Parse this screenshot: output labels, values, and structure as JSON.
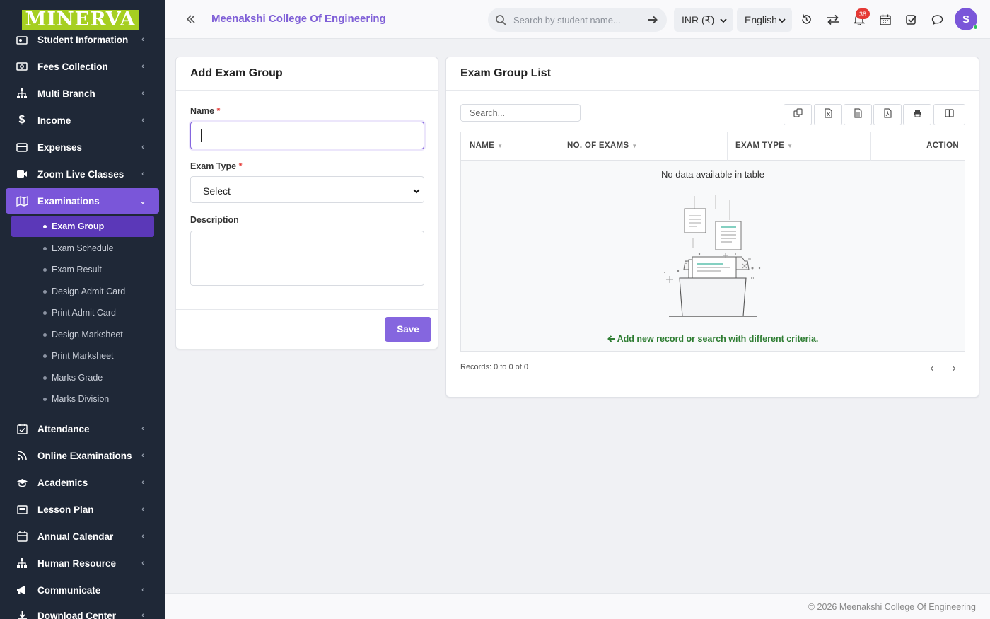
{
  "logo": {
    "text": "MINERVA",
    "color": "#a6cf21"
  },
  "sidebar": {
    "items": [
      {
        "label": "Student Information",
        "icon": "student-info-icon"
      },
      {
        "label": "Fees Collection",
        "icon": "money-icon"
      },
      {
        "label": "Multi Branch",
        "icon": "sitemap-icon"
      },
      {
        "label": "Income",
        "icon": "dollar-icon"
      },
      {
        "label": "Expenses",
        "icon": "credit-card-icon"
      },
      {
        "label": "Zoom Live Classes",
        "icon": "video-icon"
      },
      {
        "label": "Examinations",
        "icon": "map-icon",
        "active": true
      },
      {
        "label": "Attendance",
        "icon": "calendar-check-icon"
      },
      {
        "label": "Online Examinations",
        "icon": "rss-icon"
      },
      {
        "label": "Academics",
        "icon": "graduation-cap-icon"
      },
      {
        "label": "Lesson Plan",
        "icon": "list-icon"
      },
      {
        "label": "Annual Calendar",
        "icon": "calendar-icon"
      },
      {
        "label": "Human Resource",
        "icon": "sitemap-icon"
      },
      {
        "label": "Communicate",
        "icon": "megaphone-icon"
      },
      {
        "label": "Download Center",
        "icon": "download-icon"
      }
    ],
    "subitems": [
      {
        "label": "Exam Group",
        "active": true
      },
      {
        "label": "Exam Schedule"
      },
      {
        "label": "Exam Result"
      },
      {
        "label": "Design Admit Card"
      },
      {
        "label": "Print Admit Card"
      },
      {
        "label": "Design Marksheet"
      },
      {
        "label": "Print Marksheet"
      },
      {
        "label": "Marks Grade"
      },
      {
        "label": "Marks Division"
      }
    ]
  },
  "topbar": {
    "college": "Meenakshi College Of Engineering",
    "search_placeholder": "Search by student name...",
    "currency": "INR (₹)",
    "language": "English",
    "notification_count": "38",
    "avatar_initial": "S"
  },
  "form": {
    "title": "Add Exam Group",
    "name_label": "Name",
    "name_value": "",
    "exam_type_label": "Exam Type",
    "exam_type_value": "Select",
    "description_label": "Description",
    "description_value": "",
    "required_mark": "*",
    "save_label": "Save"
  },
  "list": {
    "title": "Exam Group List",
    "search_placeholder": "Search...",
    "export_buttons": [
      "copy-icon",
      "excel-icon",
      "csv-icon",
      "pdf-icon",
      "print-icon",
      "columns-icon"
    ],
    "columns": [
      "NAME",
      "NO. OF EXAMS",
      "EXAM TYPE",
      "ACTION"
    ],
    "rows": [],
    "empty_text": "No data available in table",
    "hint_text": "Add new record or search with different criteria.",
    "records": "Records: 0 to 0 of 0"
  },
  "footer": {
    "text": "© 2026 Meenakshi College Of Engineering"
  },
  "colors": {
    "accent": "#8566df",
    "sidebar": "#1f2837",
    "active_item": "#7a56d9",
    "hint": "#2e7d32",
    "badge": "#e53935"
  }
}
